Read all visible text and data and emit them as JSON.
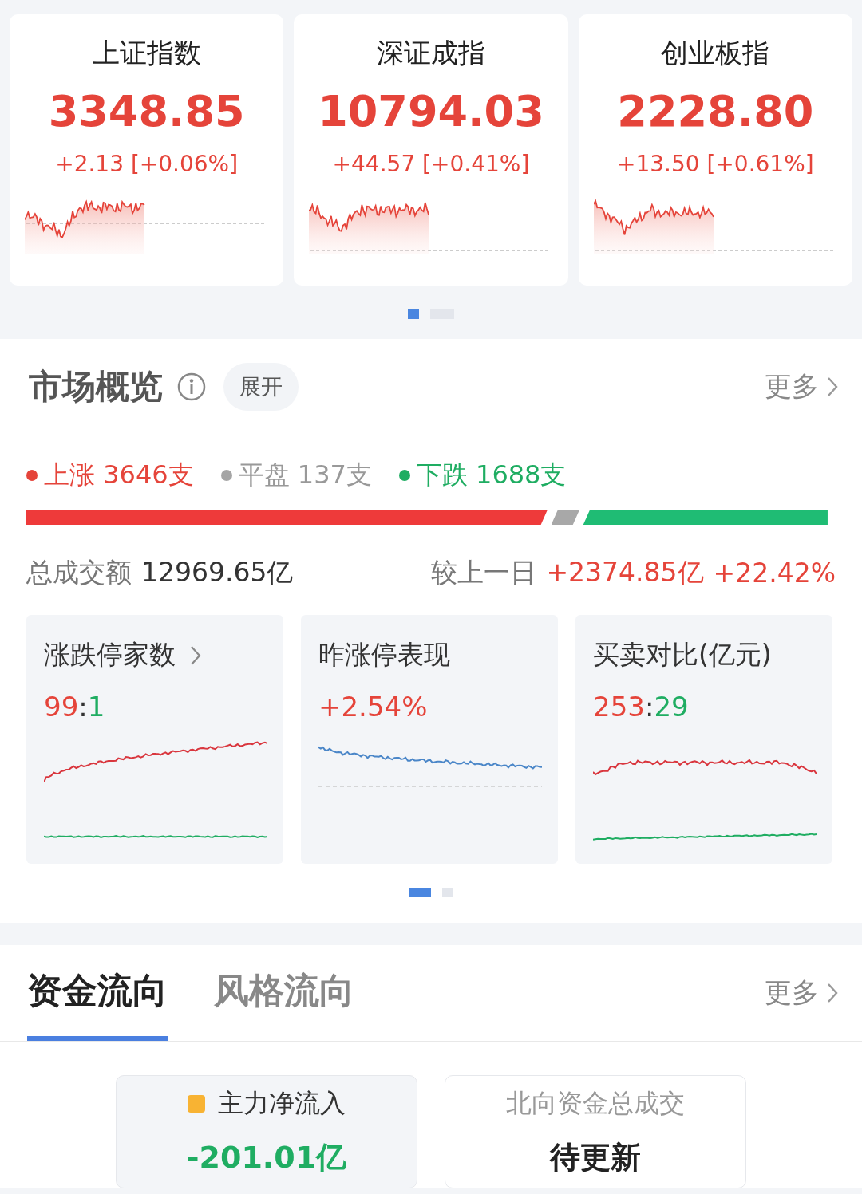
{
  "indices": [
    {
      "name": "上证指数",
      "value": "3348.85",
      "change": "+2.13 [+0.06%]"
    },
    {
      "name": "深证成指",
      "value": "10794.03",
      "change": "+44.57 [+0.41%]"
    },
    {
      "name": "创业板指",
      "value": "2228.80",
      "change": "+13.50 [+0.61%]"
    }
  ],
  "index_pager": [
    {
      "selected": true
    },
    {
      "selected": false
    }
  ],
  "overview": {
    "title": "市场概览",
    "expand": "展开",
    "more": "更多",
    "breadth": [
      {
        "kind": "up",
        "label": "上涨",
        "count": "3646支"
      },
      {
        "kind": "flat",
        "label": "平盘",
        "count": "137支"
      },
      {
        "kind": "down",
        "label": "下跌",
        "count": "1688支"
      }
    ],
    "turnover_label": "总成交额",
    "turnover": "12969.65亿",
    "compare_label": "较上一日",
    "delta": "+2374.85亿",
    "delta_pct": "+22.42%",
    "cards": [
      {
        "kind": "ratio",
        "title": "涨跌停家数",
        "link": true,
        "up": "99",
        "separator": ":",
        "down": "1"
      },
      {
        "kind": "single",
        "title": "昨涨停表现",
        "link": false,
        "value": "+2.54%"
      },
      {
        "kind": "ratio",
        "title": "买卖对比(亿元)",
        "link": false,
        "up": "253",
        "separator": ":",
        "down": "29"
      }
    ],
    "pager": [
      {
        "selected": true
      },
      {
        "selected": false
      }
    ]
  },
  "flow": {
    "tabs": [
      {
        "label": "资金流向",
        "selected": true
      },
      {
        "label": "风格流向",
        "selected": false
      }
    ],
    "more": "更多",
    "stats": [
      {
        "label": "主力净流入",
        "marker": true,
        "value": "-201.01亿",
        "kind": "down",
        "selected": true
      },
      {
        "label": "北向资金总成交",
        "marker": false,
        "value": "待更新",
        "kind": "neutral",
        "selected": false
      }
    ]
  }
}
